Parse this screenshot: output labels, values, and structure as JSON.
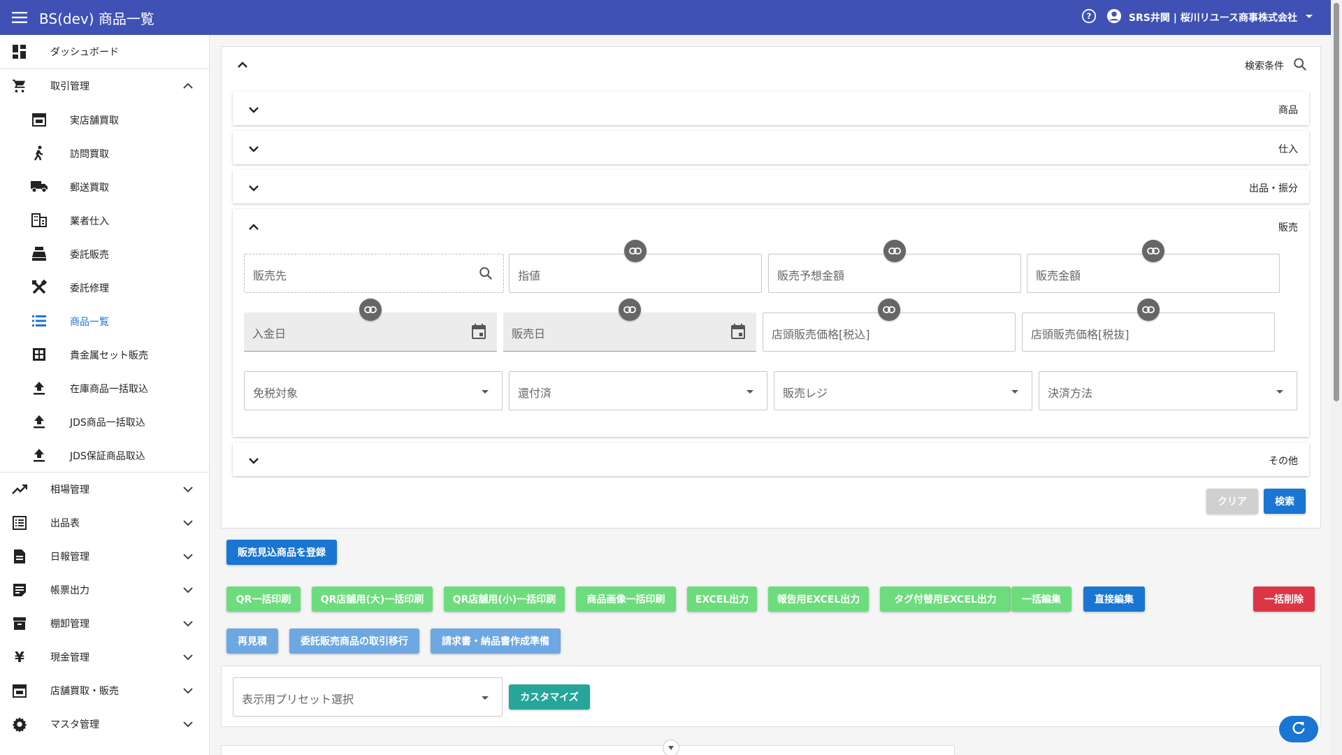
{
  "header": {
    "title": "BS(dev) 商品一覧",
    "account": "SRS井関 | 桜川リユース商事株式会社"
  },
  "sidebar": {
    "dashboard": "ダッシュボード",
    "trade": "取引管理",
    "trade_items": [
      {
        "label": "実店舗買取",
        "icon": "store-icon"
      },
      {
        "label": "訪問買取",
        "icon": "walk-icon"
      },
      {
        "label": "郵送買取",
        "icon": "truck-icon"
      },
      {
        "label": "業者仕入",
        "icon": "building-icon"
      },
      {
        "label": "委託販売",
        "icon": "cash-register-icon"
      },
      {
        "label": "委託修理",
        "icon": "tools-icon"
      },
      {
        "label": "商品一覧",
        "icon": "list-icon"
      },
      {
        "label": "貴金属セット販売",
        "icon": "grid-icon"
      },
      {
        "label": "在庫商品一括取込",
        "icon": "upload-icon"
      },
      {
        "label": "JDS商品一括取込",
        "icon": "upload-icon"
      },
      {
        "label": "JDS保証商品取込",
        "icon": "upload-icon"
      }
    ],
    "groups": [
      {
        "label": "相場管理",
        "icon": "trend-icon"
      },
      {
        "label": "出品表",
        "icon": "sheet-icon"
      },
      {
        "label": "日報管理",
        "icon": "doc-icon"
      },
      {
        "label": "帳票出力",
        "icon": "form-icon"
      },
      {
        "label": "棚卸管理",
        "icon": "box-icon"
      },
      {
        "label": "現金管理",
        "icon": "yen-icon"
      },
      {
        "label": "店舗買取・販売",
        "icon": "store-icon"
      },
      {
        "label": "マスタ管理",
        "icon": "gear-icon"
      }
    ]
  },
  "search": {
    "label": "検索条件",
    "sections": {
      "product": "商品",
      "purchase": "仕入",
      "listing": "出品・振分",
      "sales": "販売",
      "other": "その他"
    },
    "fields": {
      "customer": "販売先",
      "price_target": "指値",
      "expected_amount": "販売予想金額",
      "sales_amount": "販売金額",
      "payment_date": "入金日",
      "sales_date": "販売日",
      "store_price_incl": "店頭販売価格[税込]",
      "store_price_excl": "店頭販売価格[税抜]",
      "tax_free": "免税対象",
      "refunded": "還付済",
      "register": "販売レジ",
      "payment_method": "決済方法"
    },
    "clear": "クリア",
    "submit": "検索"
  },
  "actions": {
    "register": "販売見込商品を登録",
    "row1": [
      "QR一括印刷",
      "QR店舗用(大)一括印刷",
      "QR店舗用(小)一括印刷",
      "商品画像一括印刷",
      "EXCEL出力",
      "報告用EXCEL出力",
      "タグ付替用EXCEL出力",
      "一括編集"
    ],
    "direct_edit": "直接編集",
    "bulk_delete": "一括削除",
    "row2": [
      "再見積",
      "委託販売商品の取引移行",
      "請求書・納品書作成準備"
    ]
  },
  "preset": {
    "placeholder": "表示用プリセット選択",
    "customize": "カスタマイズ"
  },
  "colors": {
    "header": "#3f51b5",
    "primary": "#1976d2",
    "green": "#6ddc7d",
    "light_blue": "#6da8e2",
    "red": "#dc3545",
    "teal": "#26a69a"
  }
}
